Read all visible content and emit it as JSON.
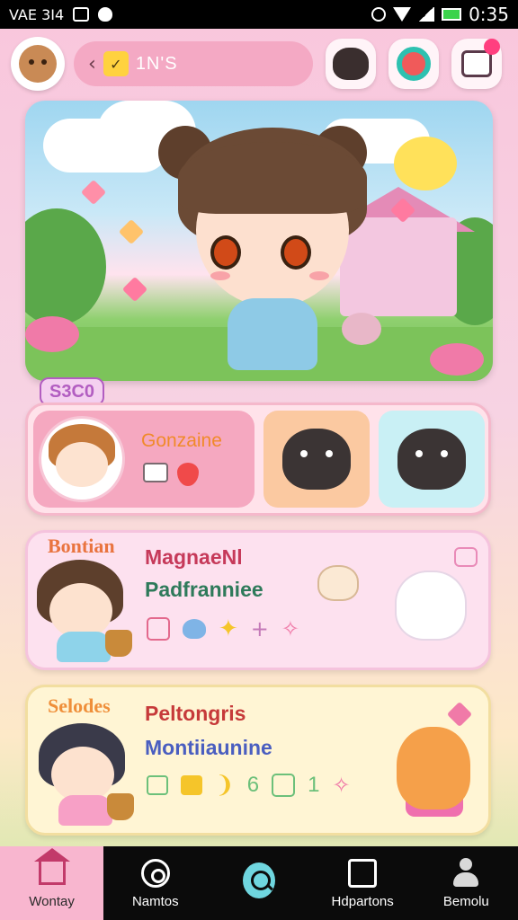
{
  "status_bar": {
    "left_text": "VAE 3I4",
    "time": "0:35"
  },
  "header": {
    "search_text": "1N'S",
    "chip_glyph": "✓",
    "notification_count": ""
  },
  "hero": {
    "badge": "S3C0"
  },
  "cards": [
    {
      "title": "Gonzaine"
    },
    {
      "tag": "Bontian",
      "title": "MagnaeNl",
      "subtitle": "Padfranniee"
    },
    {
      "tag": "Selodes",
      "title": "Peltongris",
      "subtitle": "Montiiaunine",
      "num_a": "6",
      "num_b": "1"
    }
  ],
  "bottom_nav": [
    {
      "label": "Wontay",
      "icon": "home-icon",
      "active": true
    },
    {
      "label": "Namtos",
      "icon": "pin-icon",
      "active": false
    },
    {
      "label": "",
      "icon": "search-icon",
      "active": false
    },
    {
      "label": "Hdpartons",
      "icon": "tablet-icon",
      "active": false
    },
    {
      "label": "Bemolu",
      "icon": "person-icon",
      "active": false
    }
  ],
  "colors": {
    "accent_pink": "#f8b6cf",
    "nav_bg": "#0b0b0b",
    "teal": "#6fd6df"
  }
}
